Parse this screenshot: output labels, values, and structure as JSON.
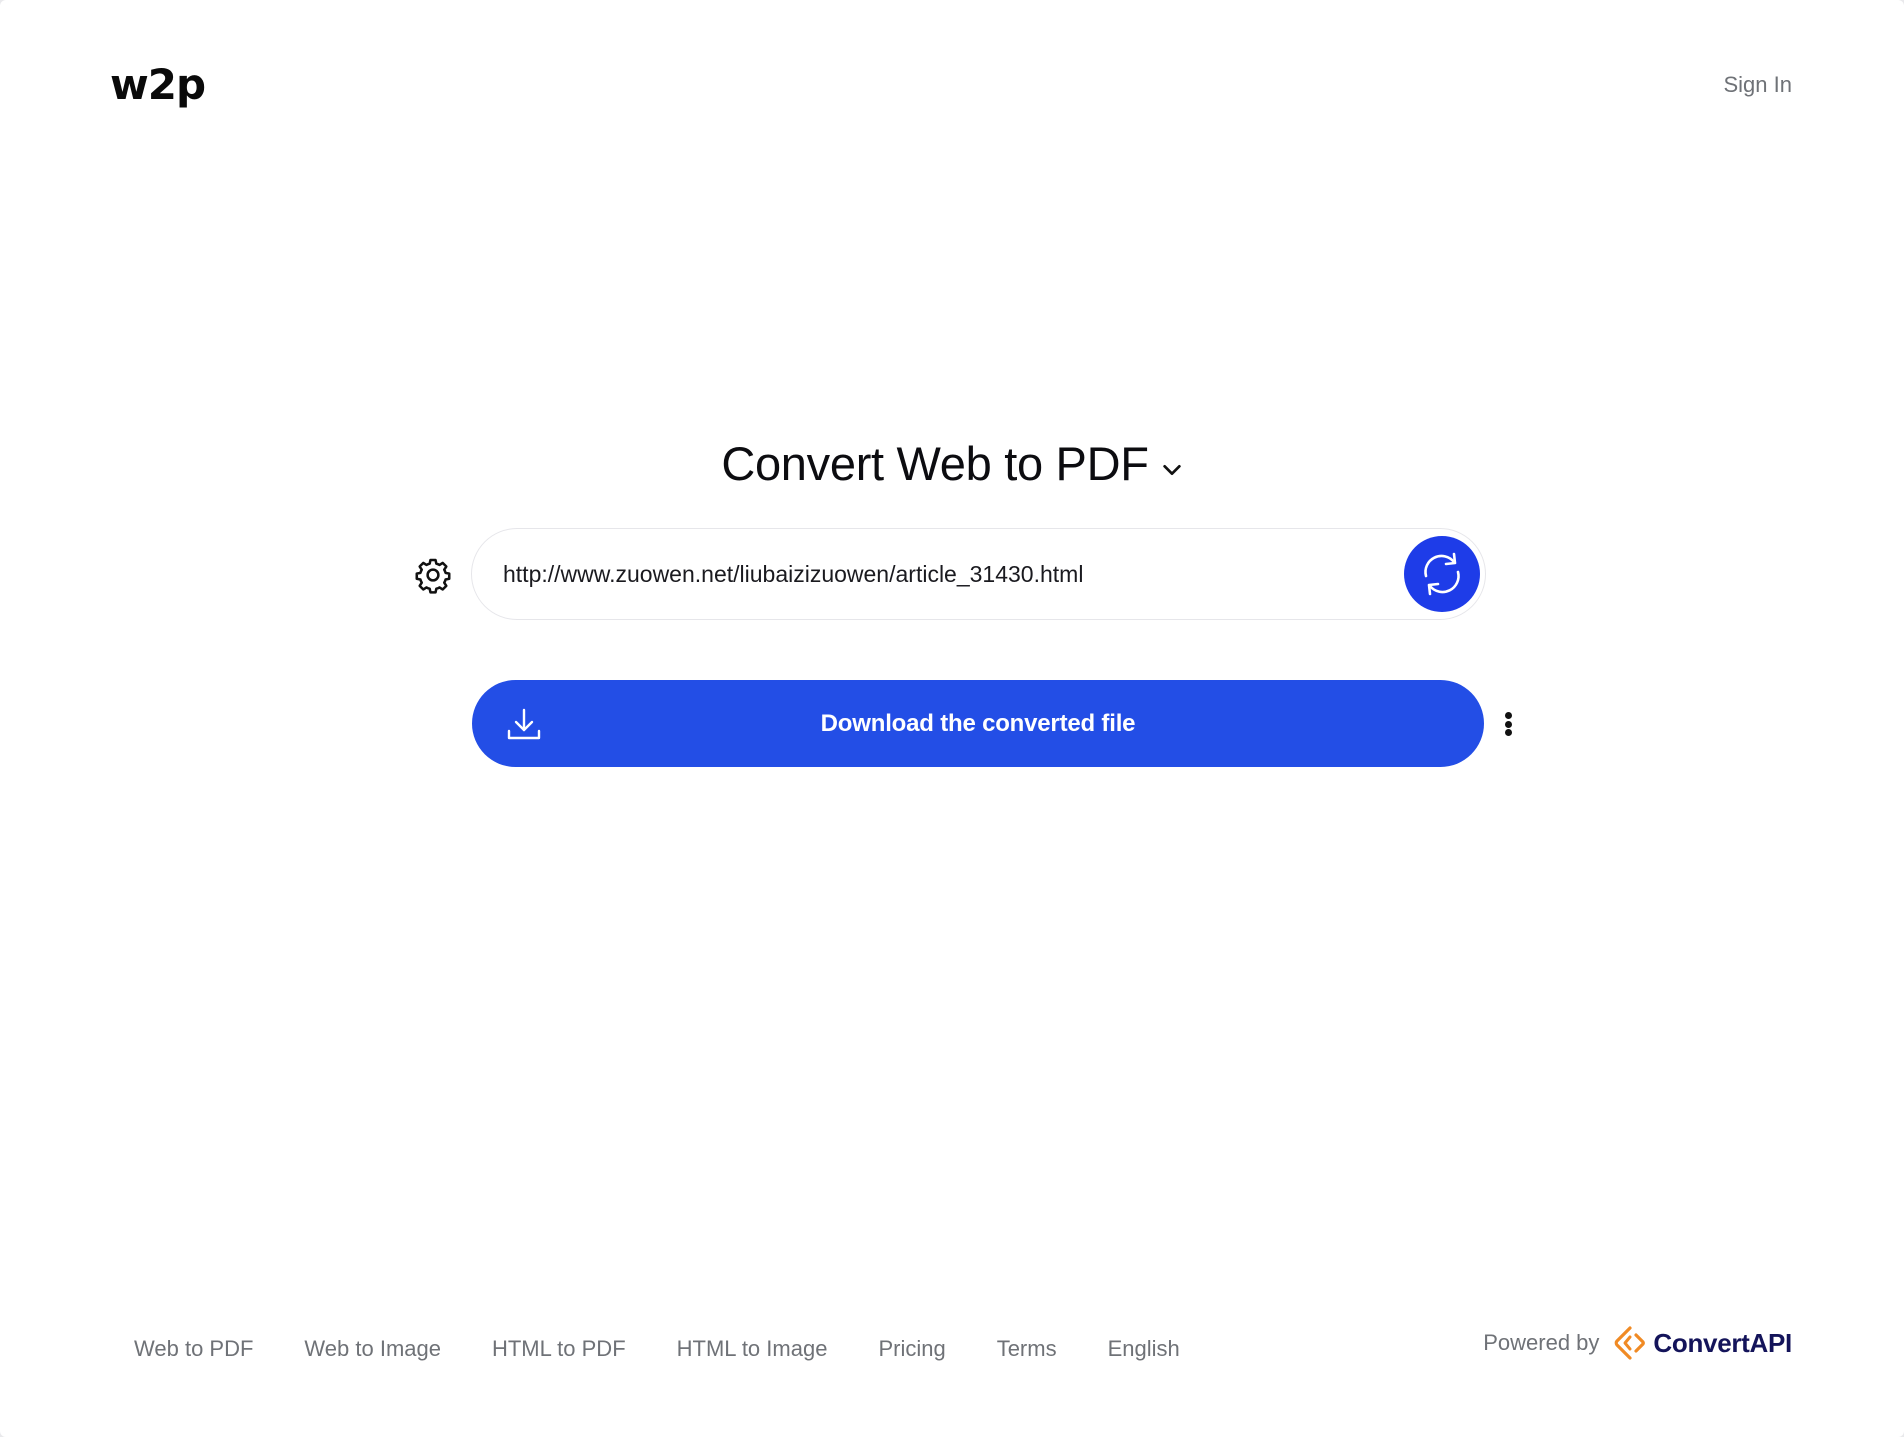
{
  "header": {
    "logo_text": "w2p",
    "sign_in": "Sign In"
  },
  "main": {
    "title": "Convert Web to PDF",
    "url_value": "http://www.zuowen.net/liubaizizuowen/article_31430.html",
    "download_label": "Download the converted file"
  },
  "footer": {
    "links": [
      "Web to PDF",
      "Web to Image",
      "HTML to PDF",
      "HTML to Image",
      "Pricing",
      "Terms",
      "English"
    ],
    "powered_by": "Powered by",
    "brand_name": "ConvertAPI"
  },
  "colors": {
    "accent": "#234ee6",
    "refresh_button": "#1e3ce8",
    "brand_orange": "#f08a24",
    "brand_navy": "#14145a"
  },
  "icons": {
    "settings": "gear-icon",
    "refresh": "refresh-icon",
    "download": "download-icon",
    "more": "more-vertical-icon",
    "title_dropdown": "chevron-down-icon"
  }
}
